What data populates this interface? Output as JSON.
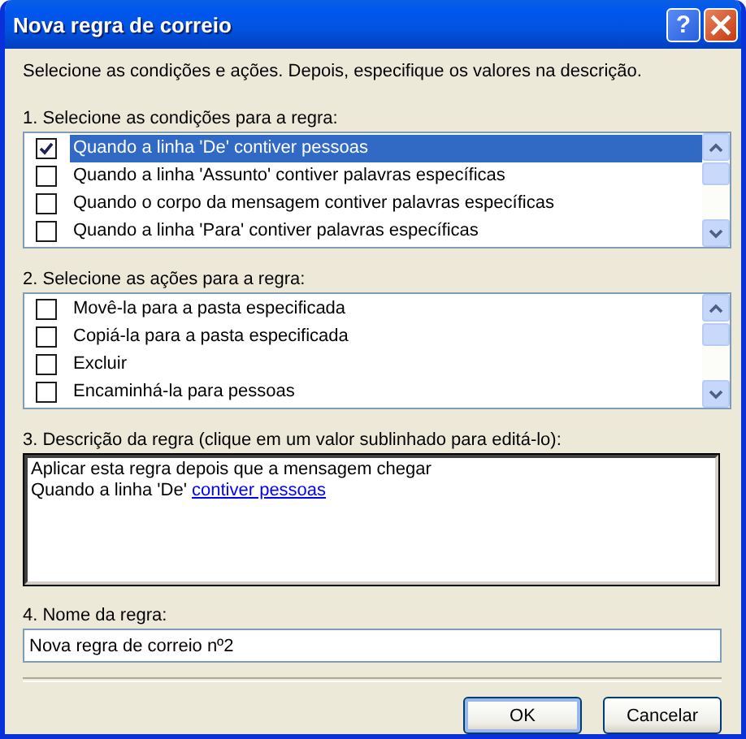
{
  "window": {
    "title": "Nova regra de correio",
    "help_button": "?"
  },
  "intro": "Selecione as condições e ações. Depois, especifique os valores na descrição.",
  "conditions": {
    "label": "1. Selecione as condições para a regra:",
    "items": [
      {
        "text": "Quando a linha 'De' contiver pessoas",
        "checked": true,
        "selected": true
      },
      {
        "text": "Quando a linha 'Assunto' contiver palavras específicas",
        "checked": false,
        "selected": false
      },
      {
        "text": "Quando o corpo da mensagem contiver palavras específicas",
        "checked": false,
        "selected": false
      },
      {
        "text": "Quando a linha 'Para' contiver palavras específicas",
        "checked": false,
        "selected": false
      }
    ]
  },
  "actions": {
    "label": "2. Selecione as ações para a regra:",
    "items": [
      {
        "text": "Movê-la para a pasta especificada",
        "checked": false,
        "selected": false
      },
      {
        "text": "Copiá-la para a pasta especificada",
        "checked": false,
        "selected": false
      },
      {
        "text": "Excluir",
        "checked": false,
        "selected": false
      },
      {
        "text": "Encaminhá-la para pessoas",
        "checked": false,
        "selected": false
      }
    ]
  },
  "description": {
    "label": "3. Descrição da regra (clique em um valor sublinhado para editá-lo):",
    "lines": [
      [
        {
          "kind": "text",
          "text": "Aplicar esta regra depois que a mensagem chegar"
        }
      ],
      [
        {
          "kind": "text",
          "text": "Quando a linha 'De' "
        },
        {
          "kind": "link",
          "text": "contiver pessoas"
        }
      ]
    ]
  },
  "name": {
    "label": "4. Nome da regra:",
    "value": "Nova regra de correio nº2"
  },
  "buttons": [
    "OK",
    "Cancelar"
  ]
}
